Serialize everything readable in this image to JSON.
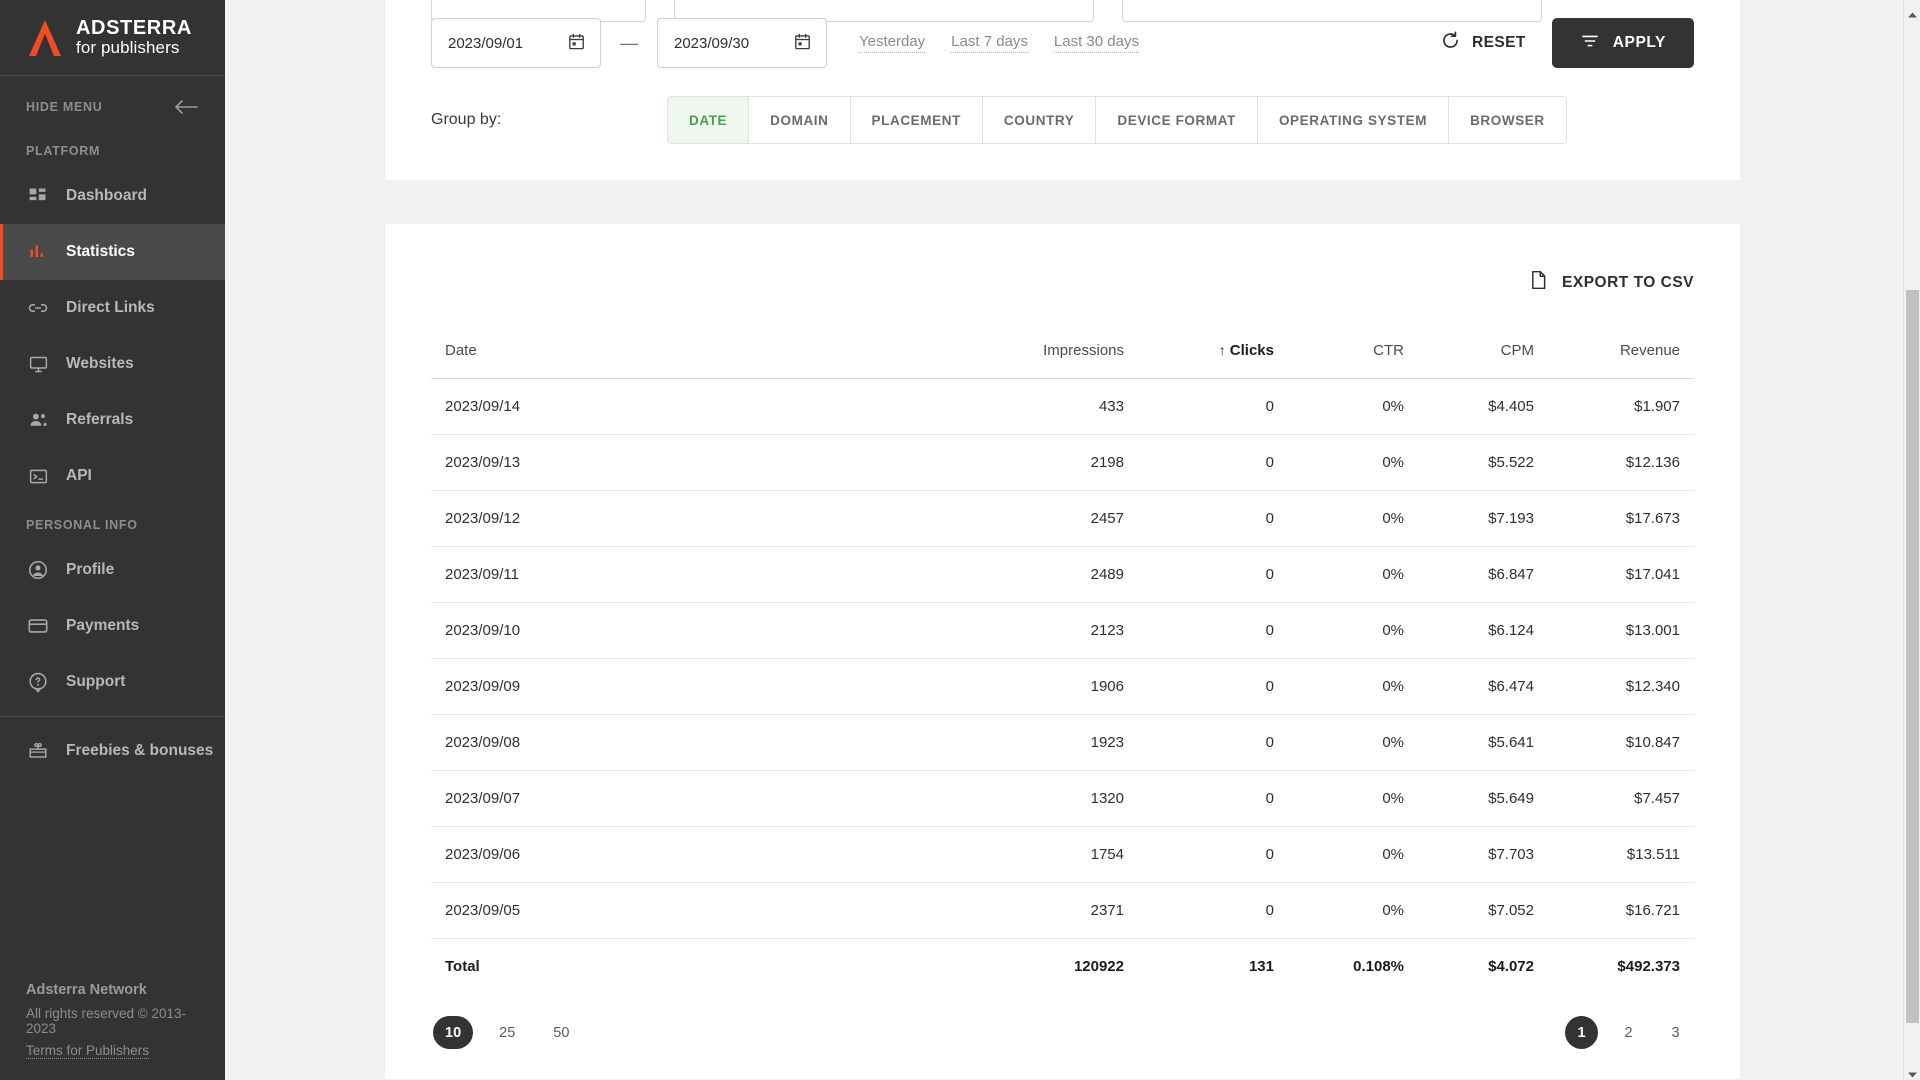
{
  "brand": {
    "name": "ADSTERRA",
    "tagline": "for publishers",
    "logo_color": "#f04b23"
  },
  "sidebar": {
    "hide_menu_label": "HIDE MENU",
    "sections": [
      {
        "label": "PLATFORM"
      },
      {
        "label": "PERSONAL INFO"
      }
    ],
    "platform_items": [
      {
        "label": "Dashboard",
        "icon": "dashboard-icon",
        "active": false
      },
      {
        "label": "Statistics",
        "icon": "statistics-icon",
        "active": true
      },
      {
        "label": "Direct Links",
        "icon": "link-icon",
        "active": false
      },
      {
        "label": "Websites",
        "icon": "monitor-icon",
        "active": false
      },
      {
        "label": "Referrals",
        "icon": "people-icon",
        "active": false
      },
      {
        "label": "API",
        "icon": "terminal-icon",
        "active": false
      }
    ],
    "personal_items": [
      {
        "label": "Profile",
        "icon": "person-circle-icon",
        "active": false
      },
      {
        "label": "Payments",
        "icon": "credit-card-icon",
        "active": false
      },
      {
        "label": "Support",
        "icon": "help-balloon-icon",
        "active": false
      }
    ],
    "extra_items": [
      {
        "label": "Freebies & bonuses",
        "icon": "gift-icon",
        "active": false
      }
    ],
    "footer": {
      "title": "Adsterra Network",
      "rights": "All rights reserved © 2013-2023",
      "terms": "Terms for Publishers"
    }
  },
  "filters": {
    "date_from": "2023/09/01",
    "date_to": "2023/09/30",
    "separator": "—",
    "quick_ranges": [
      "Yesterday",
      "Last 7 days",
      "Last 30 days"
    ],
    "reset_label": "RESET",
    "apply_label": "APPLY",
    "group_by_label": "Group by:",
    "group_by_tabs": [
      {
        "label": "DATE",
        "active": true
      },
      {
        "label": "DOMAIN",
        "active": false
      },
      {
        "label": "PLACEMENT",
        "active": false
      },
      {
        "label": "COUNTRY",
        "active": false
      },
      {
        "label": "DEVICE FORMAT",
        "active": false
      },
      {
        "label": "OPERATING SYSTEM",
        "active": false
      },
      {
        "label": "BROWSER",
        "active": false
      }
    ]
  },
  "table_panel": {
    "export_label": "EXPORT TO CSV",
    "columns": [
      "Date",
      "Impressions",
      "Clicks",
      "CTR",
      "CPM",
      "Revenue"
    ],
    "sorted_column": "Clicks",
    "sort_direction": "↑",
    "rows": [
      {
        "date": "2023/09/14",
        "impressions": "433",
        "clicks": "0",
        "ctr": "0%",
        "cpm": "$4.405",
        "revenue": "$1.907"
      },
      {
        "date": "2023/09/13",
        "impressions": "2198",
        "clicks": "0",
        "ctr": "0%",
        "cpm": "$5.522",
        "revenue": "$12.136"
      },
      {
        "date": "2023/09/12",
        "impressions": "2457",
        "clicks": "0",
        "ctr": "0%",
        "cpm": "$7.193",
        "revenue": "$17.673"
      },
      {
        "date": "2023/09/11",
        "impressions": "2489",
        "clicks": "0",
        "ctr": "0%",
        "cpm": "$6.847",
        "revenue": "$17.041"
      },
      {
        "date": "2023/09/10",
        "impressions": "2123",
        "clicks": "0",
        "ctr": "0%",
        "cpm": "$6.124",
        "revenue": "$13.001"
      },
      {
        "date": "2023/09/09",
        "impressions": "1906",
        "clicks": "0",
        "ctr": "0%",
        "cpm": "$6.474",
        "revenue": "$12.340"
      },
      {
        "date": "2023/09/08",
        "impressions": "1923",
        "clicks": "0",
        "ctr": "0%",
        "cpm": "$5.641",
        "revenue": "$10.847"
      },
      {
        "date": "2023/09/07",
        "impressions": "1320",
        "clicks": "0",
        "ctr": "0%",
        "cpm": "$5.649",
        "revenue": "$7.457"
      },
      {
        "date": "2023/09/06",
        "impressions": "1754",
        "clicks": "0",
        "ctr": "0%",
        "cpm": "$7.703",
        "revenue": "$13.511"
      },
      {
        "date": "2023/09/05",
        "impressions": "2371",
        "clicks": "0",
        "ctr": "0%",
        "cpm": "$7.052",
        "revenue": "$16.721"
      }
    ],
    "total": {
      "date": "Total",
      "impressions": "120922",
      "clicks": "131",
      "ctr": "0.108%",
      "cpm": "$4.072",
      "revenue": "$492.373"
    },
    "page_sizes": [
      {
        "label": "10",
        "active": true
      },
      {
        "label": "25",
        "active": false
      },
      {
        "label": "50",
        "active": false
      }
    ],
    "pages": [
      {
        "label": "1",
        "active": true
      },
      {
        "label": "2",
        "active": false
      },
      {
        "label": "3",
        "active": false
      }
    ]
  }
}
